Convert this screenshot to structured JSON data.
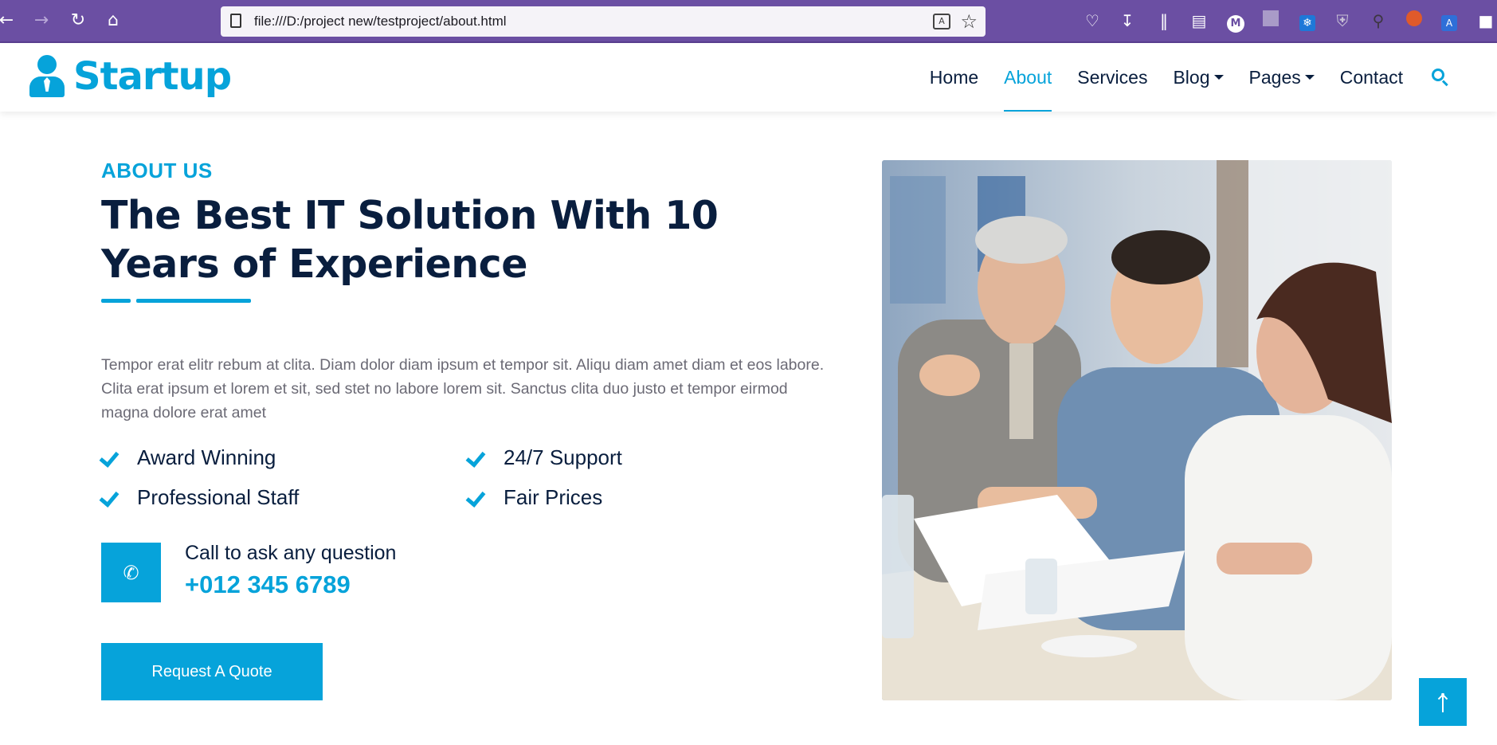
{
  "browser": {
    "url": "file:///D:/project new/testproject/about.html",
    "nav_icons": [
      "back-arrow-icon",
      "forward-arrow-icon",
      "reload-icon",
      "home-icon"
    ],
    "toolbar_icons": [
      "pocket-icon",
      "download-icon",
      "library-icon",
      "reader-view-icon",
      "profile-icon",
      "extension-square-icon",
      "extension-snowflake-icon",
      "shield-icon",
      "key-icon",
      "extension-flame-icon",
      "translate-extension-icon"
    ]
  },
  "site": {
    "logo_text": "Startup",
    "nav": {
      "home": "Home",
      "about": "About",
      "services": "Services",
      "blog": "Blog",
      "pages": "Pages",
      "contact": "Contact"
    },
    "active_nav": "About"
  },
  "about": {
    "tag": "ABOUT US",
    "headline": "The Best IT Solution With 10 Years of Experience",
    "paragraph": "Tempor erat elitr rebum at clita. Diam dolor diam ipsum et tempor sit. Aliqu diam amet diam et eos labore. Clita erat ipsum et lorem et sit, sed stet no labore lorem sit. Sanctus clita duo justo et tempor eirmod magna dolore erat amet",
    "features": [
      "Award Winning",
      "24/7 Support",
      "Professional Staff",
      "Fair Prices"
    ],
    "call_text": "Call to ask any question",
    "phone": "+012 345 6789",
    "button": "Request A Quote"
  },
  "colors": {
    "primary": "#06a3da",
    "dark": "#091e3e",
    "chrome": "#6b4fa3"
  }
}
